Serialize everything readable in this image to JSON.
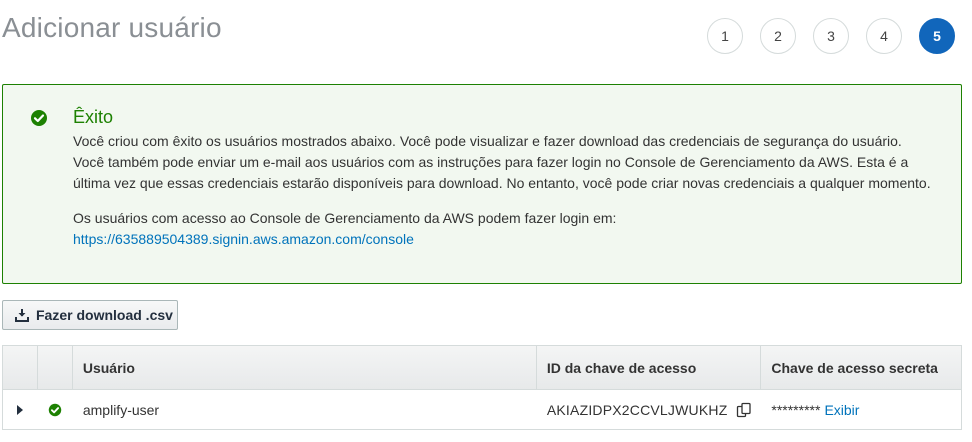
{
  "header": {
    "title": "Adicionar usuário",
    "steps": [
      "1",
      "2",
      "3",
      "4",
      "5"
    ],
    "active_step": "5"
  },
  "alert": {
    "icon": "check-circle-icon",
    "title": "Êxito",
    "line1": "Você criou com êxito os usuários mostrados abaixo. Você pode visualizar e fazer download das credenciais de segurança do usuário.",
    "line2": "Você também pode enviar um e-mail aos usuários com as instruções para fazer login no Console de Gerenciamento da AWS. Esta é a",
    "line3": "última vez que essas credenciais estarão disponíveis para download. No entanto, você pode criar novas credenciais a qualquer momento.",
    "line4": "Os usuários com acesso ao Console de Gerenciamento da AWS podem fazer login em:",
    "link": "https://635889504389.signin.aws.amazon.com/console"
  },
  "toolbar": {
    "download_label": "Fazer download .csv",
    "download_icon": "download-icon"
  },
  "table": {
    "columns": [
      "Usuário",
      "ID da chave de acesso",
      "Chave de acesso secreta"
    ],
    "rows": [
      {
        "user": "amplify-user",
        "access_key_id": "AKIAZIDPX2CCVLJWUKHZ",
        "secret_masked": "*********",
        "show_label": "Exibir"
      }
    ]
  },
  "colors": {
    "success": "#1d8102",
    "success_bg": "#f2f8f0",
    "link": "#0073bb",
    "active_step": "#1166bb"
  }
}
